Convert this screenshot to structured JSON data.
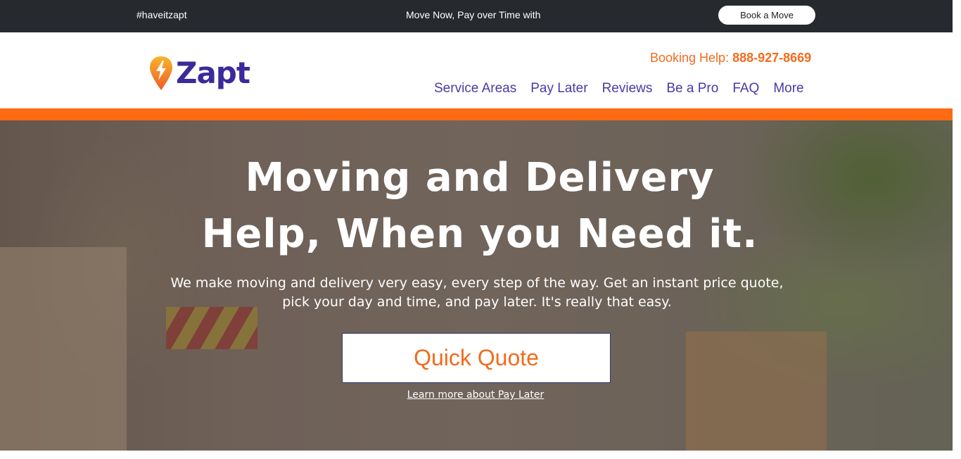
{
  "topbar": {
    "hashtag": "#haveitzapt",
    "promo": "Move Now, Pay over Time with",
    "book_button": "Book a Move",
    "background": "#262a2f"
  },
  "header": {
    "logo_text": "Zapt",
    "logo_icon": "lightning-pin-icon",
    "booking_label": "Booking Help:",
    "booking_phone": "888-927-8669",
    "nav": [
      {
        "label": "Service Areas"
      },
      {
        "label": "Pay Later"
      },
      {
        "label": "Reviews"
      },
      {
        "label": "Be a Pro"
      },
      {
        "label": "FAQ"
      },
      {
        "label": "More"
      }
    ]
  },
  "hero": {
    "headline_line1": "Moving and Delivery",
    "headline_line2": "Help, When you Need it.",
    "subtext": "We make moving and delivery very easy, every step of the way. Get an instant price quote, pick your day and time, and pay later.  It's really that easy.",
    "cta_button": "Quick Quote",
    "learn_more_link": "Learn more about Pay Later"
  },
  "colors": {
    "accent_orange": "#ff6a13",
    "brand_purple": "#3b2a9b",
    "nav_purple": "#4a3aa6"
  }
}
